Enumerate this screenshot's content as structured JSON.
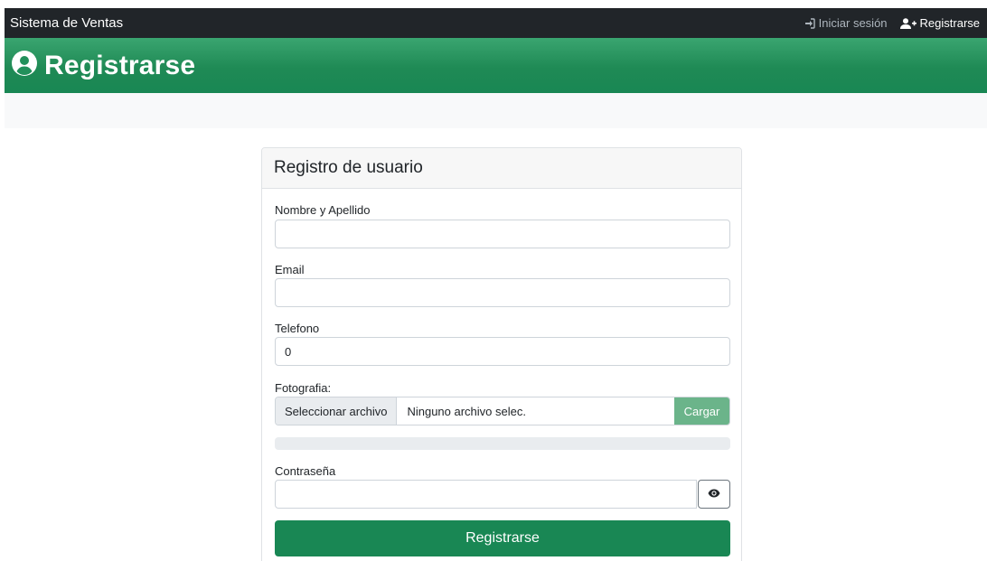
{
  "navbar": {
    "brand": "Sistema de Ventas",
    "login_label": "Iniciar sesión",
    "register_label": "Registrarse"
  },
  "header": {
    "icon": "user-circle-icon",
    "title": "Registrarse"
  },
  "form": {
    "title": "Registro de usuario",
    "name": {
      "label": "Nombre y Apellido",
      "value": ""
    },
    "email": {
      "label": "Email",
      "value": ""
    },
    "phone": {
      "label": "Telefono",
      "value": "0"
    },
    "photo": {
      "label": "Fotografia:",
      "select_button": "Seleccionar archivo",
      "file_name": "Ninguno archivo selec.",
      "upload_button": "Cargar",
      "progress": 0
    },
    "password": {
      "label": "Contraseña",
      "value": "",
      "toggle_icon": "eye-icon"
    },
    "submit_label": "Registrarse"
  },
  "colors": {
    "navbar_bg": "#212529",
    "accent": "#198754",
    "upload_button": "#6bb48a"
  }
}
